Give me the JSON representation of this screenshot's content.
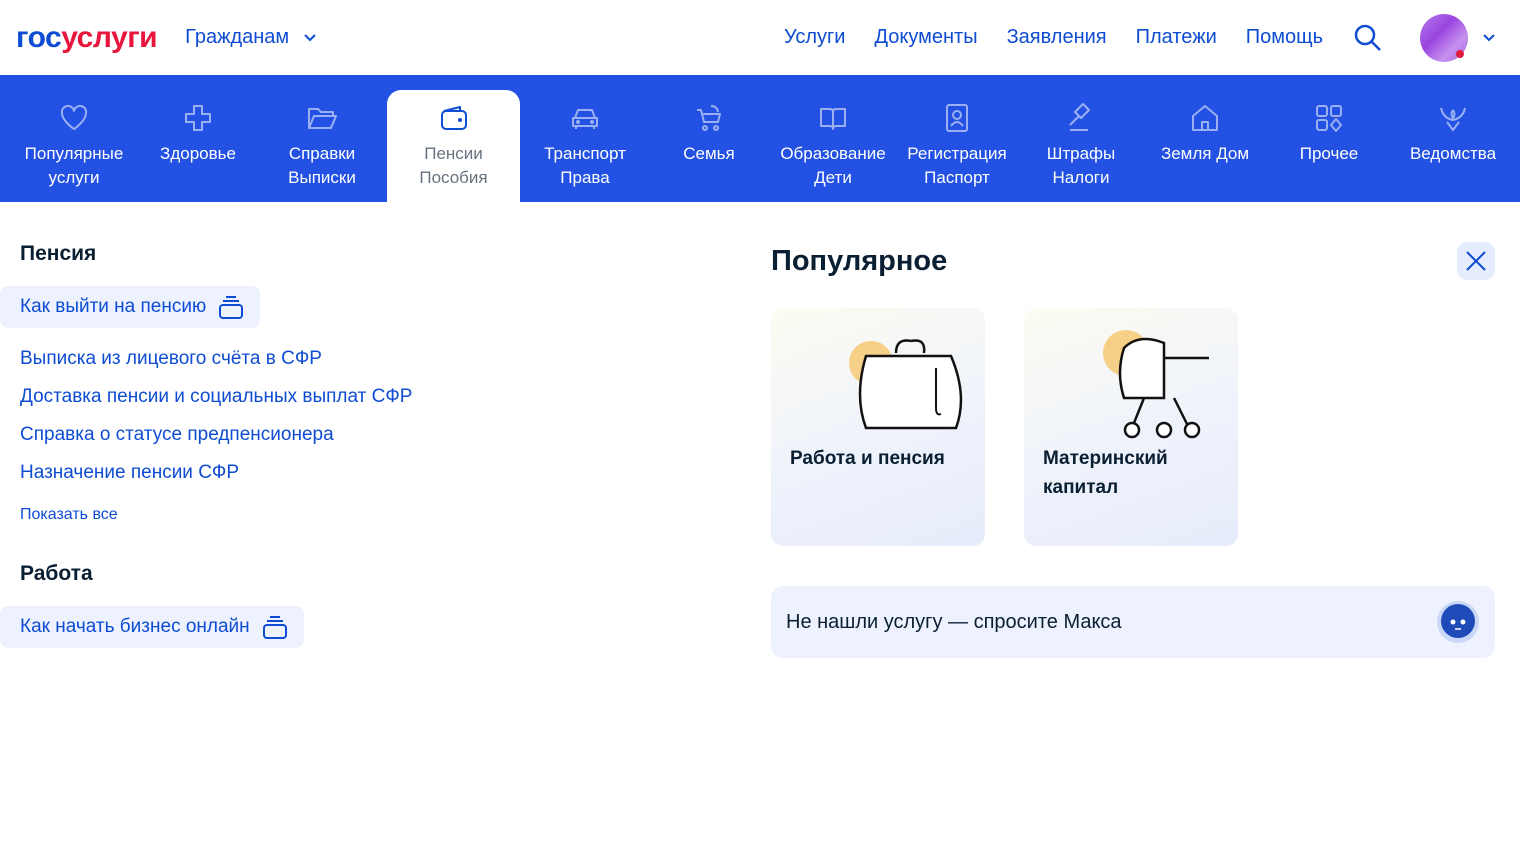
{
  "header": {
    "logo_part1": "гос",
    "logo_part2": "услуги",
    "audience": "Гражданам",
    "nav": [
      "Услуги",
      "Документы",
      "Заявления",
      "Платежи",
      "Помощь"
    ]
  },
  "categories": [
    {
      "icon": "heart-icon",
      "l1": "Популярные",
      "l2": "услуги"
    },
    {
      "icon": "plus-icon",
      "l1": "Здоровье",
      "l2": ""
    },
    {
      "icon": "folder-icon",
      "l1": "Справки",
      "l2": "Выписки"
    },
    {
      "icon": "wallet-icon",
      "l1": "Пенсии",
      "l2": "Пособия",
      "active": true
    },
    {
      "icon": "car-icon",
      "l1": "Транспорт",
      "l2": "Права"
    },
    {
      "icon": "stroller-icon",
      "l1": "Семья",
      "l2": ""
    },
    {
      "icon": "book-icon",
      "l1": "Образование",
      "l2": "Дети"
    },
    {
      "icon": "id-card-icon",
      "l1": "Регистрация",
      "l2": "Паспорт"
    },
    {
      "icon": "gavel-icon",
      "l1": "Штрафы",
      "l2": "Налоги"
    },
    {
      "icon": "house-icon",
      "l1": "Земля Дом",
      "l2": ""
    },
    {
      "icon": "grid-icon",
      "l1": "Прочее",
      "l2": ""
    },
    {
      "icon": "emblem-icon",
      "l1": "Ведомства",
      "l2": ""
    }
  ],
  "pension": {
    "title": "Пенсия",
    "featured": "Как выйти на пенсию",
    "links": [
      "Выписка из лицевого счёта в СФР",
      "Доставка пенсии и социальных выплат СФР",
      "Справка о статусе предпенсионера",
      "Назначение пенсии СФР"
    ],
    "show_all": "Показать все"
  },
  "work": {
    "title": "Работа",
    "featured": "Как начать бизнес онлайн"
  },
  "popular": {
    "title": "Популярное",
    "cards": [
      {
        "l1": "Работа и пенсия",
        "l2": ""
      },
      {
        "l1": "Материнский",
        "l2": "капитал"
      }
    ],
    "ask": "Не нашли услугу — спросите Макса"
  }
}
